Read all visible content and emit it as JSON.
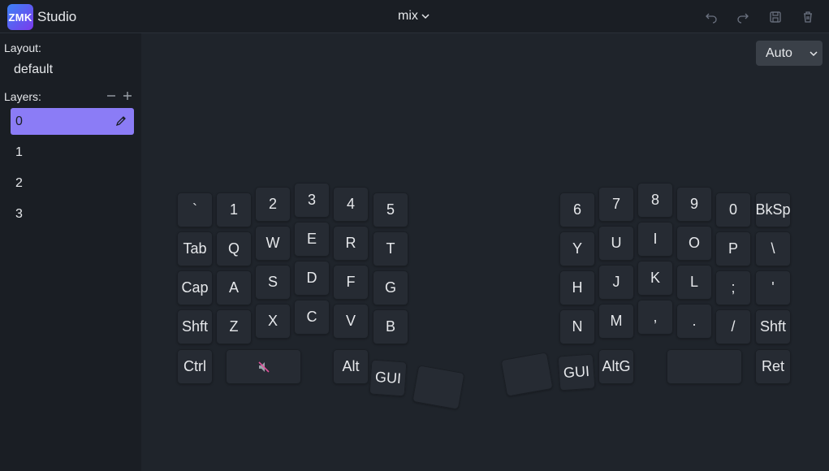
{
  "header": {
    "logo_text": "ZMK",
    "app_name": "Studio",
    "keyboard_name": "mix",
    "icons": [
      "undo-icon",
      "redo-icon",
      "save-icon",
      "trash-icon"
    ]
  },
  "sidebar": {
    "layout_label": "Layout:",
    "layout_value": "default",
    "layers_label": "Layers:",
    "layers": [
      {
        "label": "0",
        "active": true
      },
      {
        "label": "1",
        "active": false
      },
      {
        "label": "2",
        "active": false
      },
      {
        "label": "3",
        "active": false
      }
    ]
  },
  "main": {
    "zoom_value": "Auto",
    "keys": [
      "`",
      "1",
      "2",
      "3",
      "4",
      "5",
      "Tab",
      "Q",
      "W",
      "E",
      "R",
      "T",
      "Cap",
      "A",
      "S",
      "D",
      "F",
      "G",
      "Shft",
      "Z",
      "X",
      "C",
      "V",
      "B",
      "Ctrl",
      "",
      "Alt",
      "GUI",
      "",
      "6",
      "7",
      "8",
      "9",
      "0",
      "BkSp",
      "Y",
      "U",
      "I",
      "O",
      "P",
      "\\",
      "H",
      "J",
      "K",
      "L",
      ";",
      "'",
      "N",
      "M",
      ",",
      ".",
      "/",
      "Shft",
      "",
      "GUI",
      "AltG",
      "",
      "Ret"
    ],
    "mute_icon_key": "mute-icon"
  },
  "colors": {
    "background": "#1f242b",
    "sidebar": "#1a1e24",
    "key": "#262b33",
    "active_layer": "#8b7cf6"
  }
}
